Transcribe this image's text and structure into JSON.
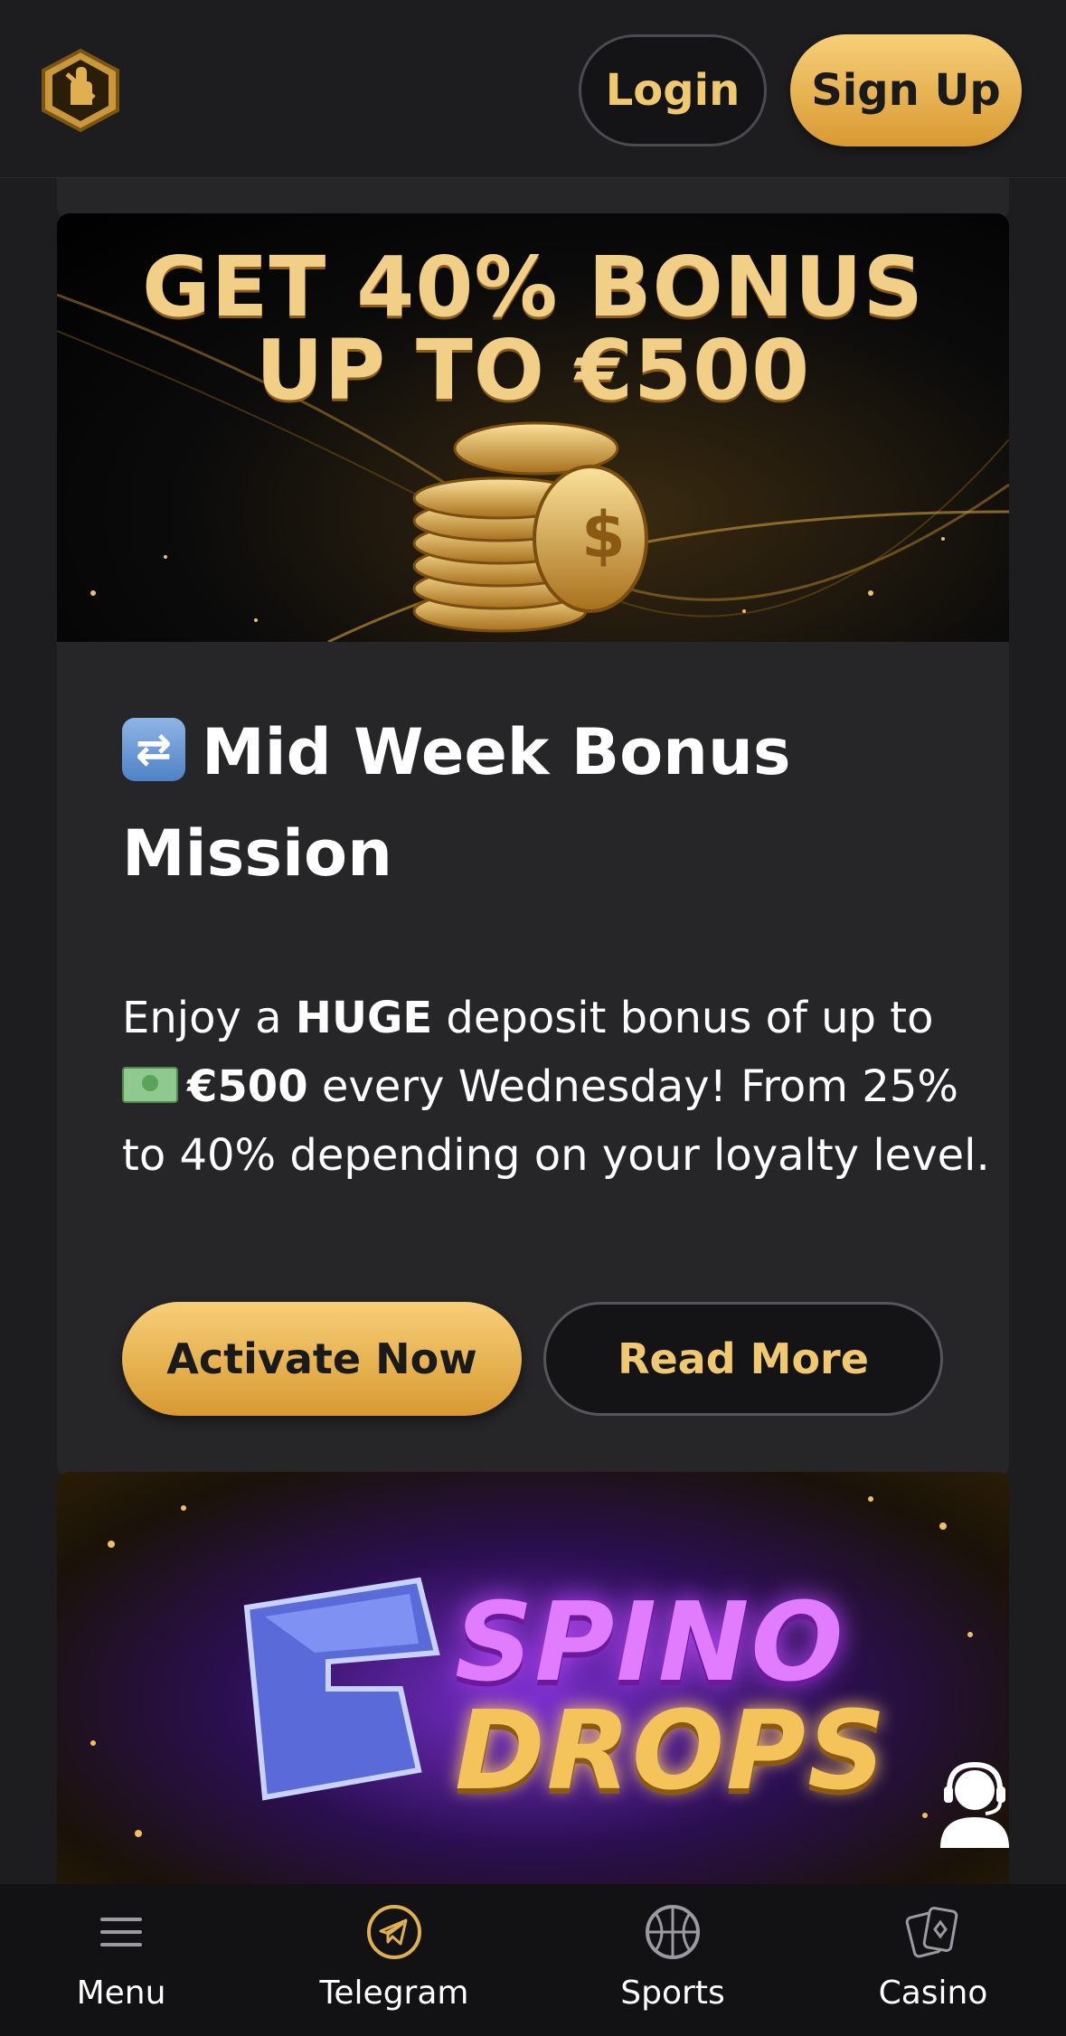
{
  "header": {
    "login_label": "Login",
    "signup_label": "Sign Up"
  },
  "promo": {
    "banner_line1": "GET 40% BONUS",
    "banner_line2": "UP TO €500",
    "title": "Mid Week Bonus Mission",
    "desc_1": "Enjoy a ",
    "desc_huge": "HUGE",
    "desc_2": " deposit bonus of up to ",
    "desc_amount": "€500",
    "desc_3": " every Wednesday! From 25% to 40% depending on your loyalty level.",
    "activate_label": "Activate Now",
    "readmore_label": "Read More"
  },
  "next_banner": {
    "line1": "SPINO",
    "line2": "DROPS"
  },
  "bottom_nav": {
    "items": [
      {
        "label": "Menu",
        "icon": "menu-icon"
      },
      {
        "label": "Telegram",
        "icon": "telegram-icon"
      },
      {
        "label": "Sports",
        "icon": "basketball-icon"
      },
      {
        "label": "Casino",
        "icon": "cards-icon"
      }
    ]
  },
  "colors": {
    "background": "#1d1d1f",
    "card": "#262628",
    "gold": "#f0c870",
    "gold_gradient_top": "#f7cf78",
    "gold_gradient_bottom": "#d89a32",
    "nav_bg": "#121214"
  }
}
